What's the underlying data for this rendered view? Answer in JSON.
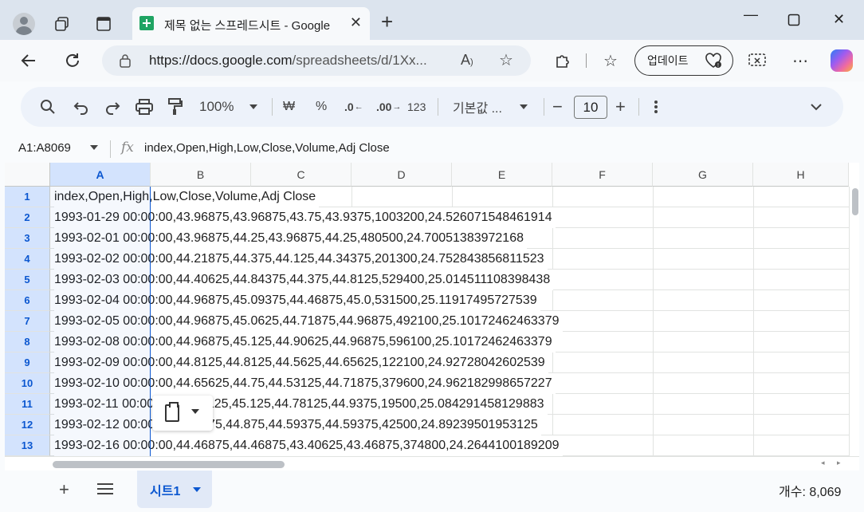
{
  "browser": {
    "tab_title": "제목 없는 스프레드시트 - Google",
    "url_host": "https://docs.google.com",
    "url_path": "/spreadsheets/d/1Xx...",
    "update_label": "업데이트"
  },
  "toolbar": {
    "zoom": "100%",
    "currency": "₩",
    "percent": "%",
    "dec_decrease": ".0",
    "dec_increase": ".00",
    "number_format": "123",
    "font": "기본값 ...",
    "font_size": "10",
    "minus": "−",
    "plus": "+"
  },
  "formula_bar": {
    "name_box": "A1:A8069",
    "fx": "fx",
    "formula": "index,Open,High,Low,Close,Volume,Adj Close"
  },
  "columns": [
    "A",
    "B",
    "C",
    "D",
    "E",
    "F",
    "G",
    "H"
  ],
  "rows": [
    {
      "num": "1",
      "text": "index,Open,High,Low,Close,Volume,Adj Close"
    },
    {
      "num": "2",
      "text": "1993-01-29 00:00:00,43.96875,43.96875,43.75,43.9375,1003200,24.526071548461914"
    },
    {
      "num": "3",
      "text": "1993-02-01 00:00:00,43.96875,44.25,43.96875,44.25,480500,24.70051383972168"
    },
    {
      "num": "4",
      "text": "1993-02-02 00:00:00,44.21875,44.375,44.125,44.34375,201300,24.752843856811523"
    },
    {
      "num": "5",
      "text": "1993-02-03 00:00:00,44.40625,44.84375,44.375,44.8125,529400,25.014511108398438"
    },
    {
      "num": "6",
      "text": "1993-02-04 00:00:00,44.96875,45.09375,44.46875,45.0,531500,25.11917495727539"
    },
    {
      "num": "7",
      "text": "1993-02-05 00:00:00,44.96875,45.0625,44.71875,44.96875,492100,25.10172462463379"
    },
    {
      "num": "8",
      "text": "1993-02-08 00:00:00,44.96875,45.125,44.90625,44.96875,596100,25.10172462463379"
    },
    {
      "num": "9",
      "text": "1993-02-09 00:00:00,44.8125,44.8125,44.5625,44.65625,122100,24.92728042602539"
    },
    {
      "num": "10",
      "text": "1993-02-10 00:00:00,44.65625,44.75,44.53125,44.71875,379600,24.962182998657227"
    },
    {
      "num": "11",
      "text": "1993-02-11 00:00:00,44.78125,45.125,44.78125,44.9375,19500,25.084291458129883"
    },
    {
      "num": "12",
      "text": "1993-02-12 00:00:00,44.9375,44.875,44.59375,44.59375,42500,24.89239501953125"
    },
    {
      "num": "13",
      "text": "1993-02-16 00:00:00,44.46875,44.46875,43.40625,43.46875,374800,24.2644100189209"
    }
  ],
  "sheets": {
    "active": "시트1"
  },
  "status": {
    "count": "개수: 8,069"
  }
}
